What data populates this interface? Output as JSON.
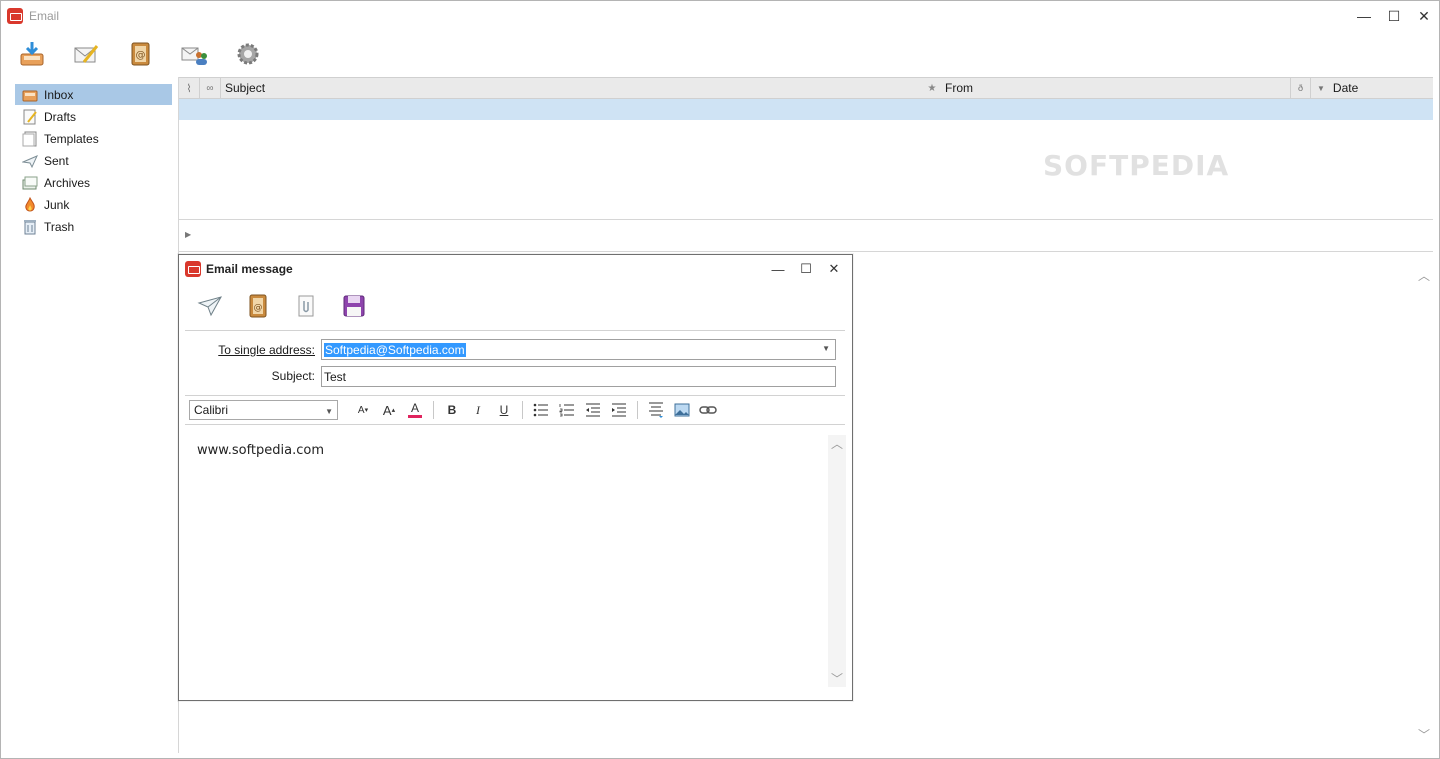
{
  "app": {
    "title": "Email"
  },
  "window_controls": {
    "minimize": "—",
    "maximize": "☐",
    "close": "✕"
  },
  "toolbar": {
    "items": [
      {
        "name": "get-mail",
        "icon": "inbox-download-icon"
      },
      {
        "name": "write",
        "icon": "compose-icon"
      },
      {
        "name": "address-book",
        "icon": "address-book-icon"
      },
      {
        "name": "contacts",
        "icon": "contacts-icon"
      },
      {
        "name": "settings",
        "icon": "gear-icon"
      }
    ]
  },
  "folders": [
    {
      "label": "Inbox",
      "icon": "inbox-icon",
      "selected": true
    },
    {
      "label": "Drafts",
      "icon": "drafts-icon"
    },
    {
      "label": "Templates",
      "icon": "templates-icon"
    },
    {
      "label": "Sent",
      "icon": "sent-icon"
    },
    {
      "label": "Archives",
      "icon": "archives-icon"
    },
    {
      "label": "Junk",
      "icon": "junk-icon"
    },
    {
      "label": "Trash",
      "icon": "trash-icon"
    }
  ],
  "message_list": {
    "columns": {
      "subject": "Subject",
      "from": "From",
      "date": "Date"
    },
    "watermark": "SOFTPEDIA"
  },
  "compose": {
    "title": "Email message",
    "to_label": "To single address:",
    "to_value": "Softpedia@Softpedia.com",
    "subject_label": "Subject:",
    "subject_value": "Test",
    "font": "Calibri",
    "body": "www.softpedia.com",
    "formatting": {
      "decrease_font": "A",
      "increase_font": "A",
      "font_color": "A",
      "bold": "B",
      "italic": "I",
      "underline": "U"
    }
  },
  "colors": {
    "accent": "#d9382c",
    "selection": "#a9c8e6",
    "row_highlight": "#cfe3f4"
  }
}
